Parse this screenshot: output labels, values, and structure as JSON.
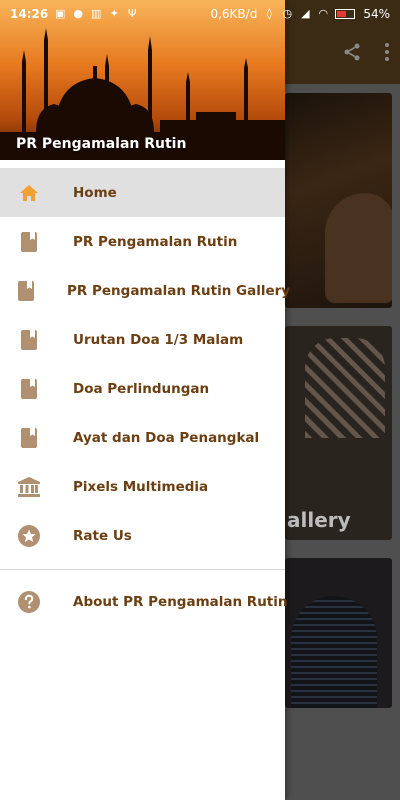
{
  "status_bar": {
    "time": "14:26",
    "speed": "0,6KB/d",
    "battery": "54%",
    "left_icons": [
      "gallery-icon",
      "chat-icon",
      "trash-icon",
      "twitter-icon",
      "usb-icon"
    ],
    "right_icons": [
      "mute-bell-icon",
      "alarm-icon",
      "signal-icon",
      "wifi-icon",
      "battery-icon"
    ]
  },
  "app_bar": {
    "actions": [
      "share-icon",
      "more-vert-icon"
    ]
  },
  "drawer": {
    "header_title": "PR Pengamalan Rutin",
    "items": [
      {
        "label": "Home",
        "icon": "home-icon",
        "active": true
      },
      {
        "label": "PR Pengamalan Rutin",
        "icon": "book-icon"
      },
      {
        "label": "PR Pengamalan Rutin Gallery",
        "icon": "book-icon"
      },
      {
        "label": "Urutan Doa 1/3 Malam",
        "icon": "book-icon"
      },
      {
        "label": "Doa Perlindungan",
        "icon": "book-icon"
      },
      {
        "label": "Ayat dan Doa Penangkal",
        "icon": "book-icon"
      },
      {
        "label": "Pixels Multimedia",
        "icon": "institution-icon"
      },
      {
        "label": "Rate Us",
        "icon": "star-circle-icon"
      }
    ],
    "footer_items": [
      {
        "label": "About PR Pengamalan Rutin",
        "icon": "help-icon"
      }
    ]
  },
  "background": {
    "card_2_caption": "allery"
  },
  "colors": {
    "accent": "#f0a030",
    "menu_text": "#6b3f12",
    "menu_icon": "#b09070",
    "active_bg": "#e0e0e0"
  }
}
